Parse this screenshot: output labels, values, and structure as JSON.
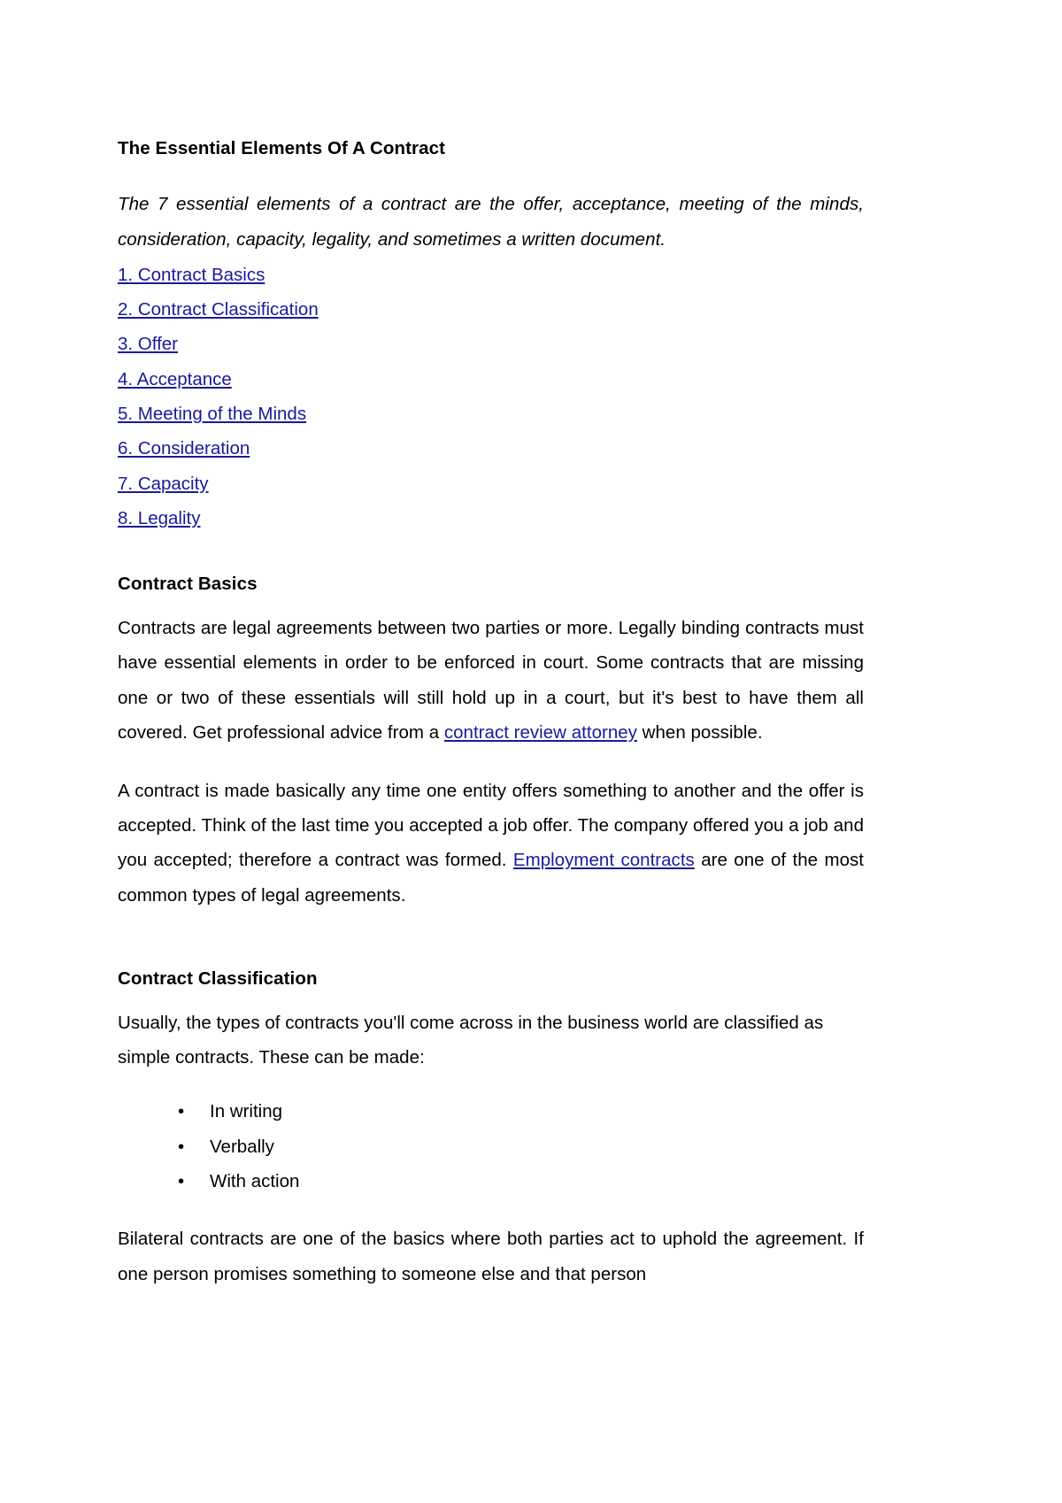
{
  "document": {
    "title": "The Essential Elements Of A Contract",
    "intro": "The 7 essential elements of a contract are the offer, acceptance, meeting of the minds, consideration, capacity, legality, and sometimes a written document.",
    "toc": [
      {
        "label": "1. Contract Basics"
      },
      {
        "label": "2. Contract Classification"
      },
      {
        "label": "3. Offer"
      },
      {
        "label": "4. Acceptance"
      },
      {
        "label": "5. Meeting of the Minds"
      },
      {
        "label": "6. Consideration"
      },
      {
        "label": "7. Capacity"
      },
      {
        "label": "8. Legality"
      }
    ],
    "sections": [
      {
        "heading": "Contract Basics",
        "p1_a": "Contracts are legal agreements between two parties or more. Legally binding contracts must have essential elements in order to be enforced in court. Some contracts that are missing one or two of these essentials will still hold up in a court, but it's best to have them all covered. Get professional advice from a ",
        "p1_link": "contract review attorney",
        "p1_b": " when possible.",
        "p2_a": "A contract is made basically any time one entity offers something to another and the offer is accepted. Think of the last time you accepted a job offer. The company offered you a job and you accepted; therefore a contract was formed. ",
        "p2_link": "Employment contracts",
        "p2_b": " are one of the most common types of legal agreements."
      },
      {
        "heading": "Contract Classification",
        "p1": "Usually, the types of contracts you'll come across in the business world are classified as simple contracts. These can be made:",
        "bullets": [
          {
            "label": "In writing"
          },
          {
            "label": "Verbally"
          },
          {
            "label": "With action"
          }
        ],
        "p2": "Bilateral contracts are one of the basics where both parties act to uphold the agreement. If one person promises something to someone else and that person"
      }
    ],
    "bullet_glyph": "•",
    "colors": {
      "link": "#1a1a9c",
      "text": "#000000",
      "background": "#ffffff"
    }
  }
}
